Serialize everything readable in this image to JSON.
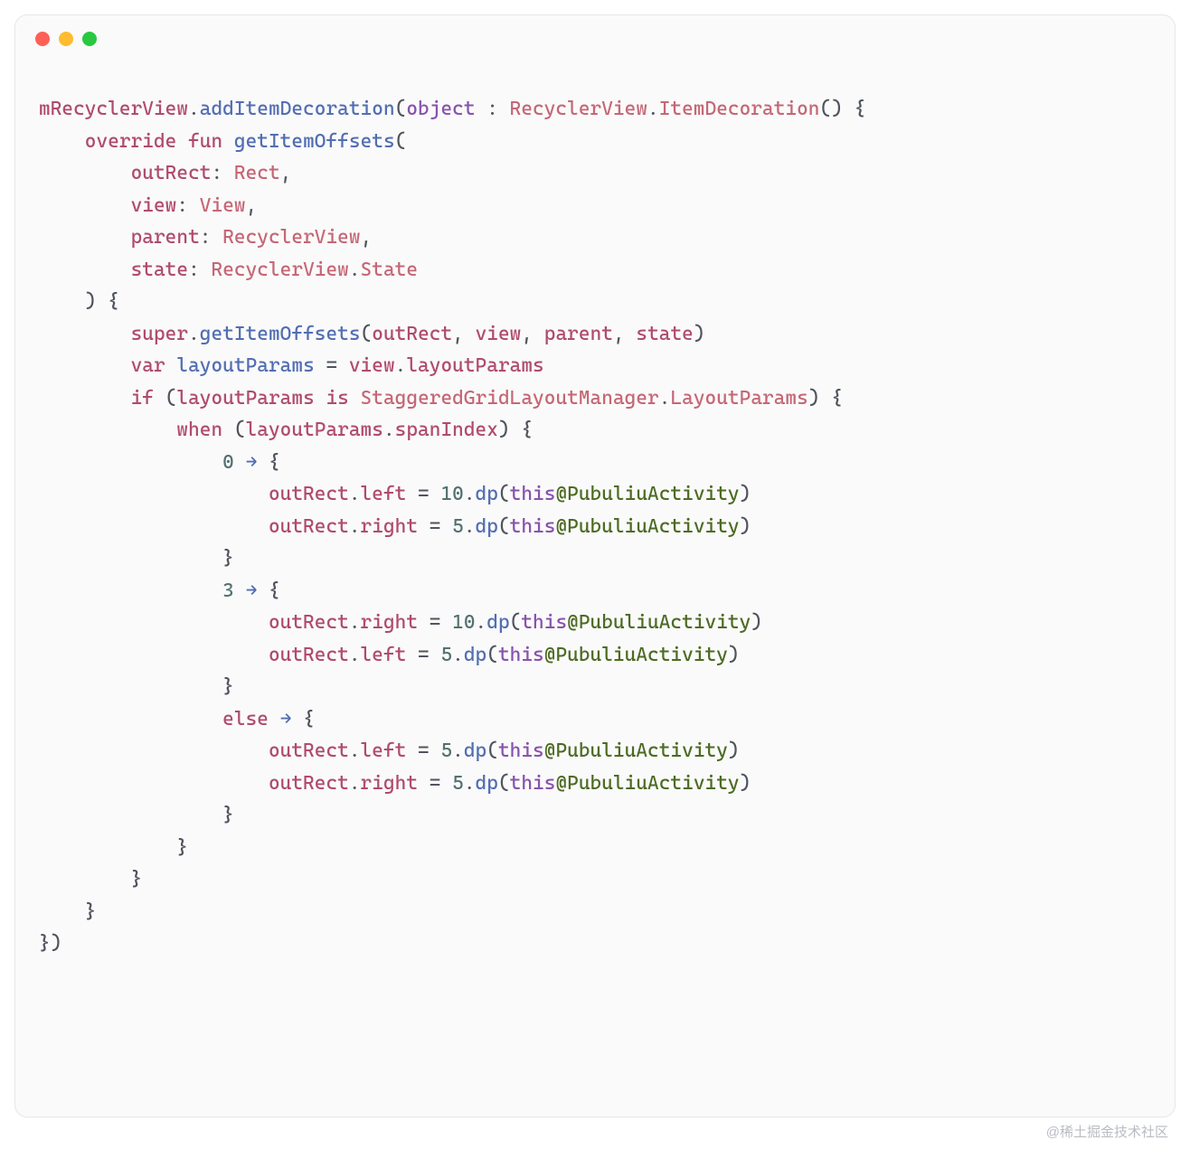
{
  "window": {
    "dots": [
      "red",
      "yellow",
      "green"
    ]
  },
  "code": {
    "lines": [
      [
        {
          "c": "t-p1",
          "t": "mRecyclerView"
        },
        {
          "c": "t-p3",
          "t": "."
        },
        {
          "c": "t-p2",
          "t": "addItemDecoration"
        },
        {
          "c": "t-p3",
          "t": "("
        },
        {
          "c": "t-kw",
          "t": "object"
        },
        {
          "c": "t-p3",
          "t": " : "
        },
        {
          "c": "t-ty",
          "t": "RecyclerView"
        },
        {
          "c": "t-p3",
          "t": "."
        },
        {
          "c": "t-ty",
          "t": "ItemDecoration"
        },
        {
          "c": "t-p3",
          "t": "() {"
        }
      ],
      [
        {
          "c": "t-p3",
          "t": "    "
        },
        {
          "c": "t-kw2",
          "t": "override"
        },
        {
          "c": "t-p3",
          "t": " "
        },
        {
          "c": "t-kw2",
          "t": "fun"
        },
        {
          "c": "t-p3",
          "t": " "
        },
        {
          "c": "t-p2",
          "t": "getItemOffsets"
        },
        {
          "c": "t-p3",
          "t": "("
        }
      ],
      [
        {
          "c": "t-p3",
          "t": "        "
        },
        {
          "c": "t-p1",
          "t": "outRect"
        },
        {
          "c": "t-p3",
          "t": ": "
        },
        {
          "c": "t-ty",
          "t": "Rect"
        },
        {
          "c": "t-p3",
          "t": ","
        }
      ],
      [
        {
          "c": "t-p3",
          "t": "        "
        },
        {
          "c": "t-p1",
          "t": "view"
        },
        {
          "c": "t-p3",
          "t": ": "
        },
        {
          "c": "t-ty",
          "t": "View"
        },
        {
          "c": "t-p3",
          "t": ","
        }
      ],
      [
        {
          "c": "t-p3",
          "t": "        "
        },
        {
          "c": "t-p1",
          "t": "parent"
        },
        {
          "c": "t-p3",
          "t": ": "
        },
        {
          "c": "t-ty",
          "t": "RecyclerView"
        },
        {
          "c": "t-p3",
          "t": ","
        }
      ],
      [
        {
          "c": "t-p3",
          "t": "        "
        },
        {
          "c": "t-p1",
          "t": "state"
        },
        {
          "c": "t-p3",
          "t": ": "
        },
        {
          "c": "t-ty",
          "t": "RecyclerView"
        },
        {
          "c": "t-p3",
          "t": "."
        },
        {
          "c": "t-ty",
          "t": "State"
        }
      ],
      [
        {
          "c": "t-p3",
          "t": "    ) {"
        }
      ],
      [
        {
          "c": "t-p3",
          "t": "        "
        },
        {
          "c": "t-sup",
          "t": "super"
        },
        {
          "c": "t-p3",
          "t": "."
        },
        {
          "c": "t-p2",
          "t": "getItemOffsets"
        },
        {
          "c": "t-p3",
          "t": "("
        },
        {
          "c": "t-p1",
          "t": "outRect"
        },
        {
          "c": "t-p3",
          "t": ", "
        },
        {
          "c": "t-p1",
          "t": "view"
        },
        {
          "c": "t-p3",
          "t": ", "
        },
        {
          "c": "t-p1",
          "t": "parent"
        },
        {
          "c": "t-p3",
          "t": ", "
        },
        {
          "c": "t-p1",
          "t": "state"
        },
        {
          "c": "t-p3",
          "t": ")"
        }
      ],
      [
        {
          "c": "t-p3",
          "t": "        "
        },
        {
          "c": "t-kw2",
          "t": "var"
        },
        {
          "c": "t-p3",
          "t": " "
        },
        {
          "c": "t-p2",
          "t": "layoutParams"
        },
        {
          "c": "t-p3",
          "t": " = "
        },
        {
          "c": "t-p1",
          "t": "view"
        },
        {
          "c": "t-p3",
          "t": "."
        },
        {
          "c": "t-p1",
          "t": "layoutParams"
        }
      ],
      [
        {
          "c": "t-p3",
          "t": "        "
        },
        {
          "c": "t-kw2",
          "t": "if"
        },
        {
          "c": "t-p3",
          "t": " ("
        },
        {
          "c": "t-p1",
          "t": "layoutParams"
        },
        {
          "c": "t-p3",
          "t": " "
        },
        {
          "c": "t-kw2",
          "t": "is"
        },
        {
          "c": "t-p3",
          "t": " "
        },
        {
          "c": "t-ty",
          "t": "StaggeredGridLayoutManager"
        },
        {
          "c": "t-p3",
          "t": "."
        },
        {
          "c": "t-ty",
          "t": "LayoutParams"
        },
        {
          "c": "t-p3",
          "t": ") {"
        }
      ],
      [
        {
          "c": "t-p3",
          "t": "            "
        },
        {
          "c": "t-kw2",
          "t": "when"
        },
        {
          "c": "t-p3",
          "t": " ("
        },
        {
          "c": "t-p1",
          "t": "layoutParams"
        },
        {
          "c": "t-p3",
          "t": "."
        },
        {
          "c": "t-p1",
          "t": "spanIndex"
        },
        {
          "c": "t-p3",
          "t": ") {"
        }
      ],
      [
        {
          "c": "t-p3",
          "t": "                "
        },
        {
          "c": "t-num",
          "t": "0"
        },
        {
          "c": "t-p3",
          "t": " "
        },
        {
          "c": "t-arr",
          "t": "→"
        },
        {
          "c": "t-p3",
          "t": " {"
        }
      ],
      [
        {
          "c": "t-p3",
          "t": "                    "
        },
        {
          "c": "t-p1",
          "t": "outRect"
        },
        {
          "c": "t-p3",
          "t": "."
        },
        {
          "c": "t-p1",
          "t": "left"
        },
        {
          "c": "t-p3",
          "t": " = "
        },
        {
          "c": "t-num",
          "t": "10"
        },
        {
          "c": "t-p3",
          "t": "."
        },
        {
          "c": "t-p2",
          "t": "dp"
        },
        {
          "c": "t-p3",
          "t": "("
        },
        {
          "c": "t-kw",
          "t": "this"
        },
        {
          "c": "t-str",
          "t": "@PubuliuActivity"
        },
        {
          "c": "t-p3",
          "t": ")"
        }
      ],
      [
        {
          "c": "t-p3",
          "t": "                    "
        },
        {
          "c": "t-p1",
          "t": "outRect"
        },
        {
          "c": "t-p3",
          "t": "."
        },
        {
          "c": "t-p1",
          "t": "right"
        },
        {
          "c": "t-p3",
          "t": " = "
        },
        {
          "c": "t-num",
          "t": "5"
        },
        {
          "c": "t-p3",
          "t": "."
        },
        {
          "c": "t-p2",
          "t": "dp"
        },
        {
          "c": "t-p3",
          "t": "("
        },
        {
          "c": "t-kw",
          "t": "this"
        },
        {
          "c": "t-str",
          "t": "@PubuliuActivity"
        },
        {
          "c": "t-p3",
          "t": ")"
        }
      ],
      [
        {
          "c": "t-p3",
          "t": "                }"
        }
      ],
      [
        {
          "c": "t-p3",
          "t": "                "
        },
        {
          "c": "t-num",
          "t": "3"
        },
        {
          "c": "t-p3",
          "t": " "
        },
        {
          "c": "t-arr",
          "t": "→"
        },
        {
          "c": "t-p3",
          "t": " {"
        }
      ],
      [
        {
          "c": "t-p3",
          "t": "                    "
        },
        {
          "c": "t-p1",
          "t": "outRect"
        },
        {
          "c": "t-p3",
          "t": "."
        },
        {
          "c": "t-p1",
          "t": "right"
        },
        {
          "c": "t-p3",
          "t": " = "
        },
        {
          "c": "t-num",
          "t": "10"
        },
        {
          "c": "t-p3",
          "t": "."
        },
        {
          "c": "t-p2",
          "t": "dp"
        },
        {
          "c": "t-p3",
          "t": "("
        },
        {
          "c": "t-kw",
          "t": "this"
        },
        {
          "c": "t-str",
          "t": "@PubuliuActivity"
        },
        {
          "c": "t-p3",
          "t": ")"
        }
      ],
      [
        {
          "c": "t-p3",
          "t": "                    "
        },
        {
          "c": "t-p1",
          "t": "outRect"
        },
        {
          "c": "t-p3",
          "t": "."
        },
        {
          "c": "t-p1",
          "t": "left"
        },
        {
          "c": "t-p3",
          "t": " = "
        },
        {
          "c": "t-num",
          "t": "5"
        },
        {
          "c": "t-p3",
          "t": "."
        },
        {
          "c": "t-p2",
          "t": "dp"
        },
        {
          "c": "t-p3",
          "t": "("
        },
        {
          "c": "t-kw",
          "t": "this"
        },
        {
          "c": "t-str",
          "t": "@PubuliuActivity"
        },
        {
          "c": "t-p3",
          "t": ")"
        }
      ],
      [
        {
          "c": "t-p3",
          "t": "                }"
        }
      ],
      [
        {
          "c": "t-p3",
          "t": "                "
        },
        {
          "c": "t-kw2",
          "t": "else"
        },
        {
          "c": "t-p3",
          "t": " "
        },
        {
          "c": "t-arr",
          "t": "→"
        },
        {
          "c": "t-p3",
          "t": " {"
        }
      ],
      [
        {
          "c": "t-p3",
          "t": "                    "
        },
        {
          "c": "t-p1",
          "t": "outRect"
        },
        {
          "c": "t-p3",
          "t": "."
        },
        {
          "c": "t-p1",
          "t": "left"
        },
        {
          "c": "t-p3",
          "t": " = "
        },
        {
          "c": "t-num",
          "t": "5"
        },
        {
          "c": "t-p3",
          "t": "."
        },
        {
          "c": "t-p2",
          "t": "dp"
        },
        {
          "c": "t-p3",
          "t": "("
        },
        {
          "c": "t-kw",
          "t": "this"
        },
        {
          "c": "t-str",
          "t": "@PubuliuActivity"
        },
        {
          "c": "t-p3",
          "t": ")"
        }
      ],
      [
        {
          "c": "t-p3",
          "t": "                    "
        },
        {
          "c": "t-p1",
          "t": "outRect"
        },
        {
          "c": "t-p3",
          "t": "."
        },
        {
          "c": "t-p1",
          "t": "right"
        },
        {
          "c": "t-p3",
          "t": " = "
        },
        {
          "c": "t-num",
          "t": "5"
        },
        {
          "c": "t-p3",
          "t": "."
        },
        {
          "c": "t-p2",
          "t": "dp"
        },
        {
          "c": "t-p3",
          "t": "("
        },
        {
          "c": "t-kw",
          "t": "this"
        },
        {
          "c": "t-str",
          "t": "@PubuliuActivity"
        },
        {
          "c": "t-p3",
          "t": ")"
        }
      ],
      [
        {
          "c": "t-p3",
          "t": "                }"
        }
      ],
      [
        {
          "c": "t-p3",
          "t": "            }"
        }
      ],
      [
        {
          "c": "t-p3",
          "t": "        }"
        }
      ],
      [
        {
          "c": "t-p3",
          "t": "    }"
        }
      ],
      [
        {
          "c": "t-p3",
          "t": "})"
        }
      ]
    ]
  },
  "watermark": "@稀土掘金技术社区"
}
